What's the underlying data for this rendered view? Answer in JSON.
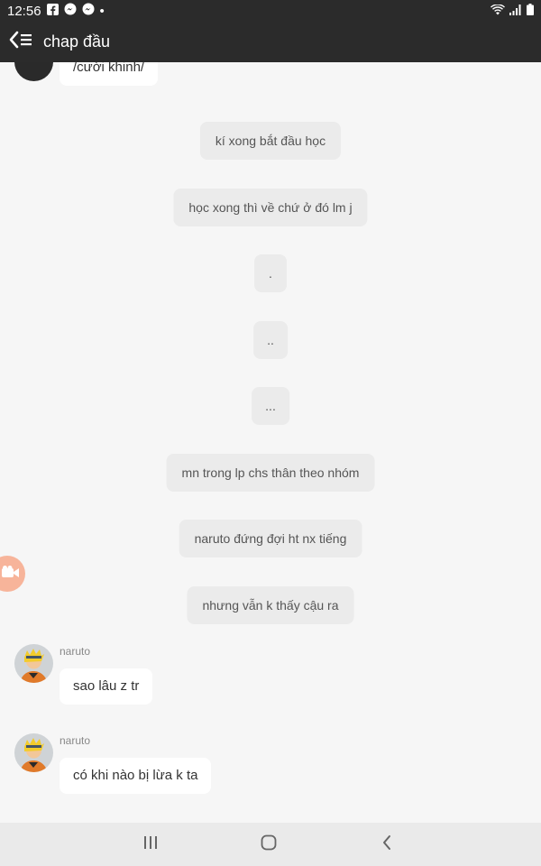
{
  "status_bar": {
    "time": "12:56",
    "dot": "•"
  },
  "header": {
    "title": "chap đầu"
  },
  "messages": {
    "top_partial": "/cười khinh/",
    "narration": [
      "kí xong bắt đầu học",
      "học xong thì về chứ ở đó lm j",
      ".",
      "..",
      "...",
      "mn trong lp chs thân theo nhóm",
      "naruto đứng đợi ht nx tiếng",
      "nhưng vẫn k thấy cậu ra"
    ],
    "chat": [
      {
        "sender": "naruto",
        "text": "sao lâu z tr"
      },
      {
        "sender": "naruto",
        "text": "có khi nào bị lừa k ta"
      }
    ]
  },
  "icons": {
    "back": "back-arrow-icon",
    "fab": "video-camera-icon",
    "nav_recent": "recent-apps-icon",
    "nav_home": "home-icon",
    "nav_back": "nav-back-icon"
  },
  "colors": {
    "bar": "#2b2b2b",
    "background": "#f6f6f6",
    "narration_bg": "#ebebeb",
    "bubble_bg": "#ffffff",
    "fab": "#f7b49a"
  }
}
